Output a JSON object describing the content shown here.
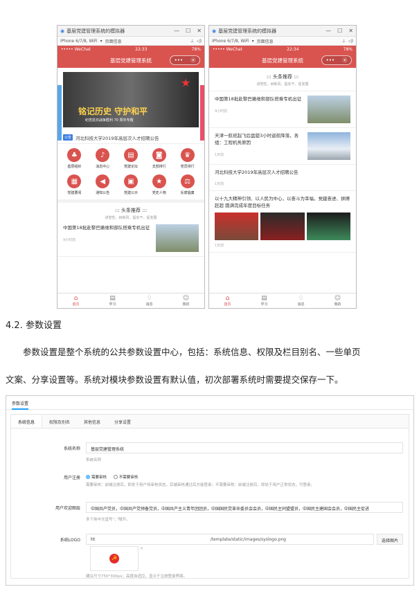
{
  "phone_left": {
    "window_title": "基层党建管理系统的模拟器",
    "device": "iPhone 6/7/8, WiFi",
    "page_info": "页面信息",
    "carrier": "••••• WeChat",
    "time": "22:33",
    "battery": "78%",
    "app_title": "基层党建管理系统",
    "banner_title": "铭记历史 守护和平",
    "banner_sub": "纪念抗日战争胜利 70 周年专题",
    "notice_tag": "公告",
    "notice_text": "河北科技大学2019年高层次人才招聘公告",
    "grid": [
      {
        "label": "基层组织",
        "icon": "users-icon"
      },
      {
        "label": "消息中心",
        "icon": "bell-icon"
      },
      {
        "label": "党建论坛",
        "icon": "chat-icon"
      },
      {
        "label": "支部排行",
        "icon": "rank-icon"
      },
      {
        "label": "党员排行",
        "icon": "trophy-icon"
      },
      {
        "label": "党建要闻",
        "icon": "news-icon"
      },
      {
        "label": "通知公告",
        "icon": "megaphone-icon"
      },
      {
        "label": "党建公示",
        "icon": "folder-icon"
      },
      {
        "label": "党史人物",
        "icon": "star-icon"
      },
      {
        "label": "反腐倡廉",
        "icon": "scale-icon"
      }
    ],
    "section_title": "::: 头条推荐 :::",
    "section_sub": "讲党性、树新风、提实干、促发展",
    "news": {
      "title": "中国第18批赴黎巴嫩维和部队搭乘专机出征",
      "time": "9小时前"
    }
  },
  "phone_right": {
    "window_title": "基层党建管理系统的模拟器",
    "device": "iPhone 6/7/8, WiFi",
    "page_info": "页面信息",
    "carrier": "••••• WeChat",
    "time": "22:34",
    "battery": "78%",
    "app_title": "基层党建管理系统",
    "section_title": "::: 头条推荐 :::",
    "section_sub": "讲党性、树新风、提实干、促发展",
    "news": [
      {
        "title": "中国第18批赴黎巴嫩维和部队搭乘专机出征",
        "time": "9小时前"
      },
      {
        "title": "天津一航班起飞后盘旋3小时返航降落，各组：工程机务原因",
        "time": "1天前"
      },
      {
        "title": "河北科技大学2019年高层次人才招聘公告",
        "time": "1天前"
      },
      {
        "title": "以十九大精神引领、以人民为中心，以奋斗为幸福，党建奋进、拼搏赶超 圆满完成年度目标任务",
        "time": "1天前"
      }
    ]
  },
  "tabbar": [
    {
      "label": "首页",
      "icon": "home-icon"
    },
    {
      "label": "学习",
      "icon": "book-icon"
    },
    {
      "label": "消息",
      "icon": "bell-icon"
    },
    {
      "label": "我的",
      "icon": "user-icon"
    }
  ],
  "doc": {
    "heading": "4.2. 参数设置",
    "para1": "参数设置是整个系统的公共参数设置中心，包括：系统信息、权限及栏目别名、一些单页",
    "para2": "文案、分享设置等。系统对模块参数设置有默认值，初次部署系统时需要提交保存一下。"
  },
  "settings": {
    "title": "参数设置",
    "tabs": [
      "系统信息",
      "权限及别名",
      "其他信息",
      "分享设置"
    ],
    "system_name_label": "系统名称",
    "system_name_value": "基层党建管理系统",
    "system_name_hint": "系统名称",
    "register_label": "用户注册",
    "register_opt1": "需要审核",
    "register_opt2": "不需要审核",
    "register_hint": "需要审核：前端注册后，即处于用户待审核状态，后端审核通过后方能登录；不需要审核：前端注册后，即处于用户正常状态，可登录。",
    "welcome_label": "用户欢迎图层",
    "welcome_value": "中国共产党员，中国共产党预备党员，中国共产主义青年团团员，中国国民党革命委员会会员，中国民主同盟盟员，中国民主建国会会员，中国民主促进",
    "welcome_hint": "多个用中文逗号“，”隔开。",
    "logo_label": "系统LOGO",
    "logo_prefix": "ht",
    "logo_path": "/template/static/images/syslogo.png",
    "logo_button": "选择图片",
    "logo_hint": "建议尺寸750*300px；高度自适应，显示于注册登录界面。"
  }
}
